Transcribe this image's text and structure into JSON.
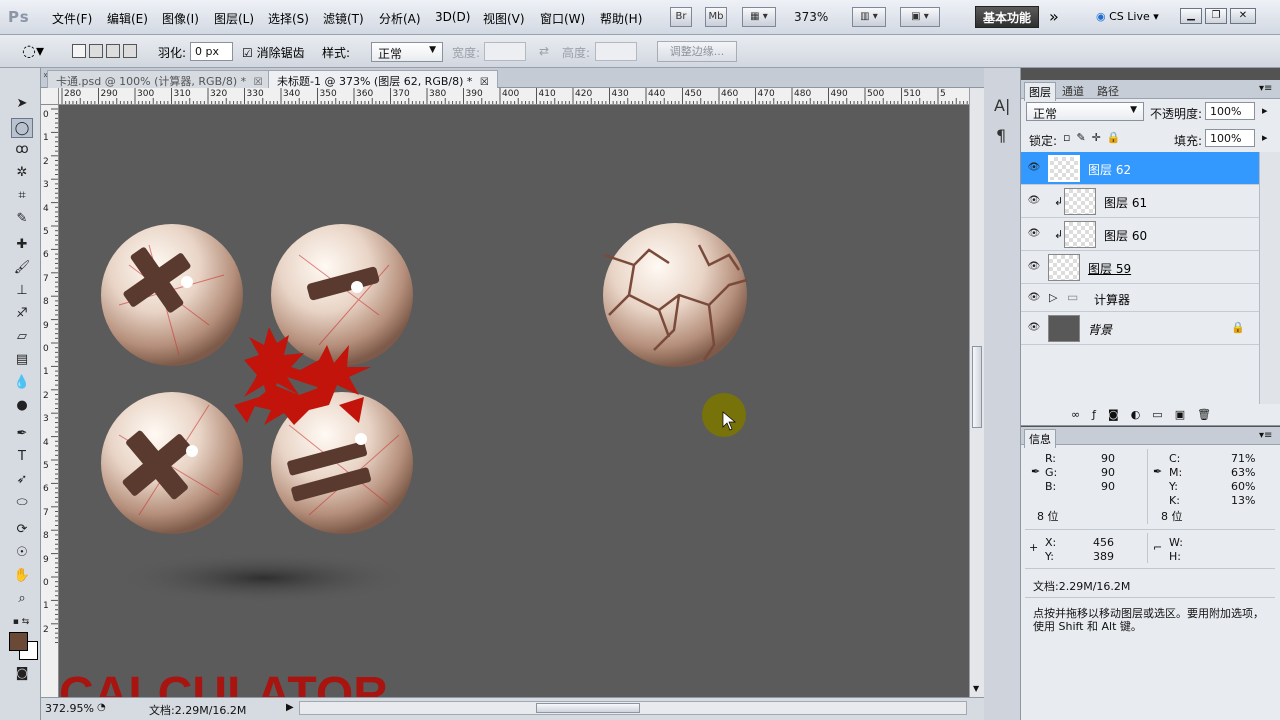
{
  "app": {
    "logo": "Ps"
  },
  "menu": [
    "文件(F)",
    "编辑(E)",
    "图像(I)",
    "图层(L)",
    "选择(S)",
    "滤镜(T)",
    "分析(A)",
    "3D(D)",
    "视图(V)",
    "窗口(W)",
    "帮助(H)"
  ],
  "menubar": {
    "br": "Br",
    "mb": "Mb",
    "zoom": "373%",
    "workspace": "基本功能",
    "cslive": "CS Live"
  },
  "options": {
    "feather_label": "羽化:",
    "feather_value": "0 px",
    "antialias_label": "消除锯齿",
    "style_label": "样式:",
    "style_value": "正常",
    "width_label": "宽度:",
    "height_label": "高度:",
    "refine_label": "调整边缘..."
  },
  "tabs": [
    {
      "label": "卡通.psd @ 100% (计算器, RGB/8) *"
    },
    {
      "label": "未标题-1 @ 373% (图层 62, RGB/8) *"
    }
  ],
  "ruler_top": [
    "280",
    "290",
    "300",
    "310",
    "320",
    "330",
    "340",
    "350",
    "360",
    "370",
    "380",
    "390",
    "400",
    "410",
    "420",
    "430",
    "440",
    "450",
    "460",
    "470",
    "480",
    "490",
    "500",
    "510",
    "5"
  ],
  "ruler_left": [
    "0",
    "1",
    "2",
    "3",
    "4",
    "5",
    "6",
    "7",
    "8",
    "9",
    "0",
    "1",
    "2",
    "3",
    "4",
    "5",
    "6",
    "7",
    "8",
    "9",
    "0",
    "1",
    "2"
  ],
  "canvas": {
    "bottom_text": "CALCULATOR"
  },
  "status": {
    "zoom": "372.95%",
    "doc": "文档:2.29M/16.2M"
  },
  "layers": {
    "tabs": [
      "图层",
      "通道",
      "路径"
    ],
    "blend_mode": "正常",
    "opacity_label": "不透明度:",
    "opacity": "100%",
    "lock_label": "锁定:",
    "fill_label": "填充:",
    "fill": "100%",
    "items": [
      {
        "name": "图层 62"
      },
      {
        "name": "图层 61"
      },
      {
        "name": "图层 60"
      },
      {
        "name": "图层 59"
      },
      {
        "name": "计算器"
      },
      {
        "name": "背景"
      }
    ]
  },
  "info": {
    "title": "信息",
    "r_label": "R:",
    "r": "90",
    "g_label": "G:",
    "g": "90",
    "b_label": "B:",
    "b": "90",
    "c_label": "C:",
    "c": "71%",
    "m_label": "M:",
    "m": "63%",
    "y_label": "Y:",
    "y": "60%",
    "k_label": "K:",
    "k": "13%",
    "bits_left": "8 位",
    "bits_right": "8 位",
    "x_label": "X:",
    "x": "456",
    "y2_label": "Y:",
    "y2": "389",
    "w_label": "W:",
    "h_label": "H:",
    "doc": "文档:2.29M/16.2M",
    "hint": "点按并拖移以移动图层或选区。要用附加选项，使用 Shift 和 Alt 键。"
  },
  "colors": {
    "foreground": "#6a4a37",
    "background": "#ffffff",
    "selection": "#3399ff",
    "canvas": "#5b5b5b"
  }
}
